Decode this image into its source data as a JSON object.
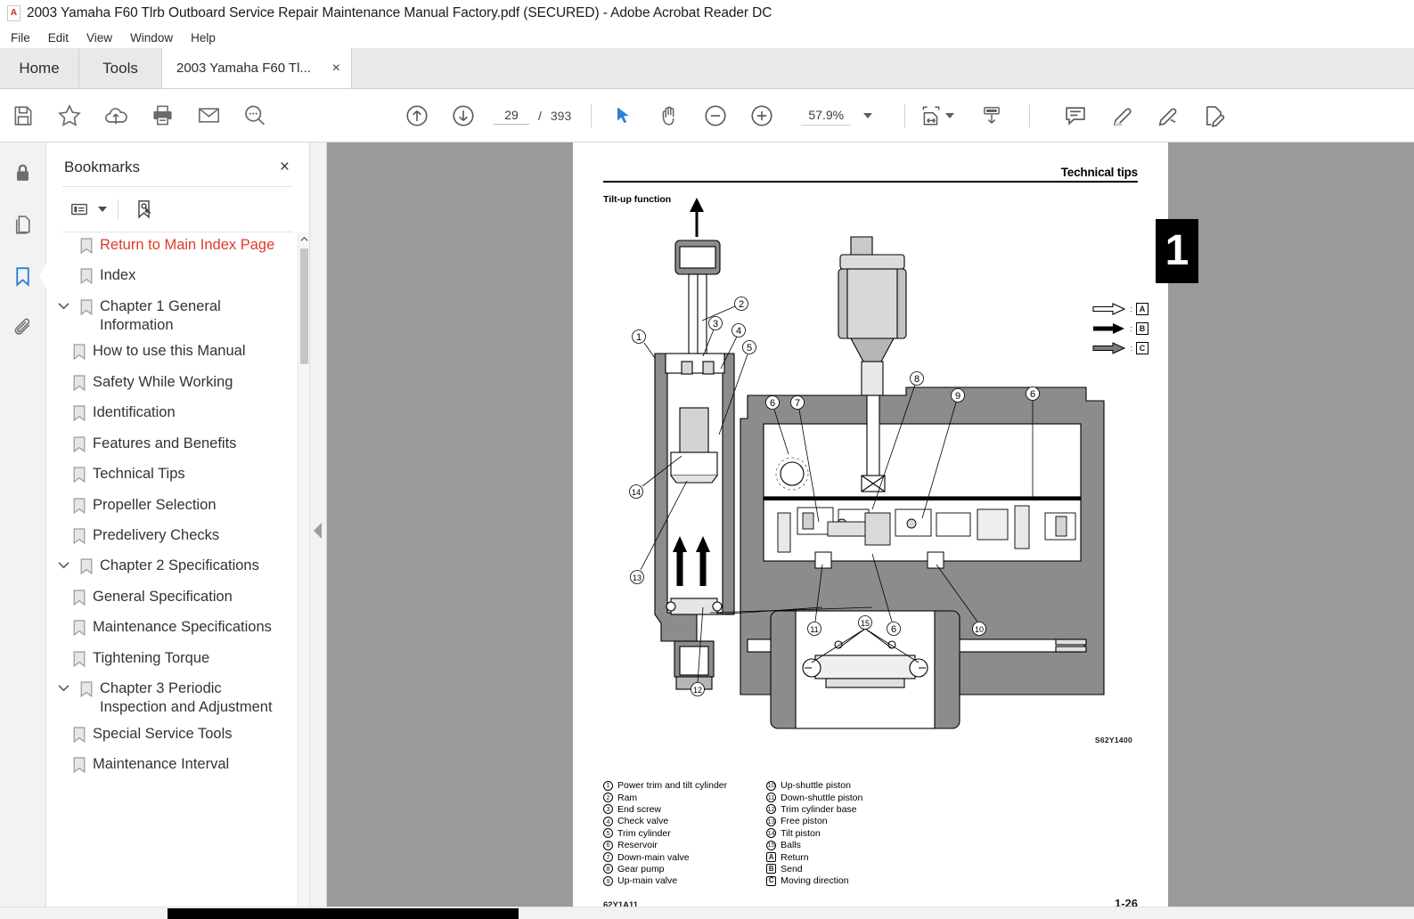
{
  "window": {
    "title": "2003 Yamaha F60 Tlrb Outboard Service Repair Maintenance Manual Factory.pdf (SECURED) - Adobe Acrobat Reader DC",
    "doc_icon": "pdf-document-icon"
  },
  "menubar": [
    "File",
    "Edit",
    "View",
    "Window",
    "Help"
  ],
  "tabs": {
    "home": "Home",
    "tools": "Tools",
    "document": "2003 Yamaha F60 Tl...",
    "close": "×"
  },
  "toolbar": {
    "left_icons": [
      "save-icon",
      "star-icon",
      "cloud-upload-icon",
      "print-icon",
      "email-icon",
      "search-icon"
    ],
    "prev_page": "previous-page-icon",
    "next_page": "next-page-icon",
    "page_current": "29",
    "page_sep": "/",
    "page_total": "393",
    "select_tool": "select-cursor-icon",
    "hand_tool": "hand-tool-icon",
    "zoom_out": "zoom-out-icon",
    "zoom_in": "zoom-in-icon",
    "zoom_level": "57.9%",
    "fit_page": "fit-page-icon",
    "scroll_mode": "page-scroll-icon",
    "comment": "comment-icon",
    "highlight": "highlight-icon",
    "sign": "sign-icon",
    "fill_and_sign": "fill-and-sign-icon"
  },
  "rail": [
    {
      "name": "security-lock-icon",
      "active": false
    },
    {
      "name": "page-thumbnails-icon",
      "active": false
    },
    {
      "name": "bookmarks-icon",
      "active": true
    },
    {
      "name": "attachments-icon",
      "active": false
    }
  ],
  "bookmarks_panel": {
    "title": "Bookmarks",
    "close": "×",
    "options_icon": "bookmark-options-icon",
    "new_bookmark_icon": "new-bookmark-icon",
    "items": [
      {
        "label": "Return to Main Index Page",
        "level": 0,
        "expandable": false,
        "red": true
      },
      {
        "label": "Index",
        "level": 0,
        "expandable": false,
        "red": false
      },
      {
        "label": "Chapter 1 General Information",
        "level": 0,
        "expandable": true,
        "red": false
      },
      {
        "label": "How to use this Manual",
        "level": 1,
        "expandable": false,
        "red": false
      },
      {
        "label": "Safety While Working",
        "level": 1,
        "expandable": false,
        "red": false
      },
      {
        "label": "Identification",
        "level": 1,
        "expandable": false,
        "red": false
      },
      {
        "label": "Features and Benefits",
        "level": 1,
        "expandable": false,
        "red": false
      },
      {
        "label": "Technical Tips",
        "level": 1,
        "expandable": false,
        "red": false
      },
      {
        "label": "Propeller Selection",
        "level": 1,
        "expandable": false,
        "red": false
      },
      {
        "label": "Predelivery Checks",
        "level": 1,
        "expandable": false,
        "red": false
      },
      {
        "label": "Chapter 2 Specifications",
        "level": 0,
        "expandable": true,
        "red": false
      },
      {
        "label": "General Specification",
        "level": 1,
        "expandable": false,
        "red": false
      },
      {
        "label": "Maintenance Specifications",
        "level": 1,
        "expandable": false,
        "red": false
      },
      {
        "label": "Tightening Torque",
        "level": 1,
        "expandable": false,
        "red": false
      },
      {
        "label": "Chapter 3 Periodic Inspection and Adjustment",
        "level": 0,
        "expandable": true,
        "red": false
      },
      {
        "label": "Special Service Tools",
        "level": 1,
        "expandable": false,
        "red": false
      },
      {
        "label": "Maintenance Interval",
        "level": 1,
        "expandable": false,
        "red": false
      }
    ]
  },
  "document_page": {
    "header_title": "Technical tips",
    "subtitle": "Tilt-up function",
    "chapter_tab": "1",
    "figure_id": "S62Y1400",
    "footer_code": "62Y1A11",
    "footer_page": "1-26",
    "arrow_legend": [
      {
        "symbol": "white-arrow-icon",
        "code": "A"
      },
      {
        "symbol": "black-arrow-icon",
        "code": "B"
      },
      {
        "symbol": "gray-arrow-icon",
        "code": "C"
      }
    ],
    "legend_left": [
      {
        "num": "1",
        "text": "Power trim and tilt cylinder"
      },
      {
        "num": "2",
        "text": "Ram"
      },
      {
        "num": "3",
        "text": "End screw"
      },
      {
        "num": "4",
        "text": "Check valve"
      },
      {
        "num": "5",
        "text": "Trim cylinder"
      },
      {
        "num": "6",
        "text": "Reservoir"
      },
      {
        "num": "7",
        "text": "Down-main valve"
      },
      {
        "num": "8",
        "text": "Gear pump"
      },
      {
        "num": "9",
        "text": "Up-main valve"
      }
    ],
    "legend_right": [
      {
        "num": "10",
        "text": "Up-shuttle piston",
        "square": false
      },
      {
        "num": "11",
        "text": "Down-shuttle piston",
        "square": false
      },
      {
        "num": "12",
        "text": "Trim cylinder base",
        "square": false
      },
      {
        "num": "13",
        "text": "Free piston",
        "square": false
      },
      {
        "num": "14",
        "text": "Tilt piston",
        "square": false
      },
      {
        "num": "15",
        "text": "Balls",
        "square": false
      },
      {
        "num": "A",
        "text": "Return",
        "square": true
      },
      {
        "num": "B",
        "text": "Send",
        "square": true
      },
      {
        "num": "C",
        "text": "Moving direction",
        "square": true
      }
    ],
    "callouts": [
      "1",
      "2",
      "3",
      "4",
      "5",
      "6",
      "7",
      "8",
      "9",
      "10",
      "11",
      "12",
      "13",
      "14",
      "15"
    ]
  },
  "colors": {
    "accent": "#2b7fd4",
    "bookmark_red": "#e03a28",
    "viewport_gray": "#9a9a9a",
    "chrome_gray": "#e9e9e9"
  }
}
